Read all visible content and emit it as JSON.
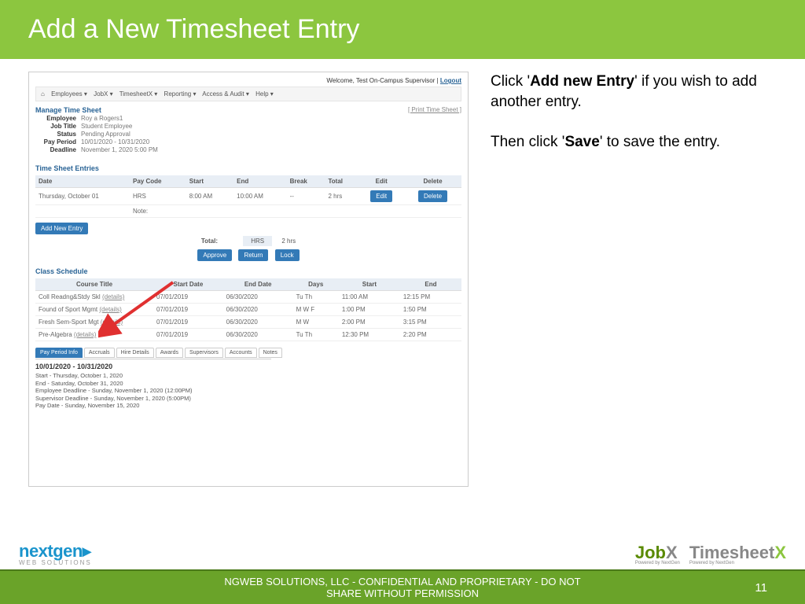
{
  "slide": {
    "title": "Add a New Timesheet Entry",
    "inst1a": "Click '",
    "inst1b": "Add new Entry",
    "inst1c": "' if you wish to add another entry.",
    "inst2a": "Then click '",
    "inst2b": "Save",
    "inst2c": "' to save the entry."
  },
  "app": {
    "welcome": "Welcome, Test On-Campus Supervisor  |  ",
    "logout": "Logout",
    "nav": {
      "home": "⌂",
      "emp": "Employees ▾",
      "jobx": "JobX ▾",
      "tsx": "TimesheetX ▾",
      "rep": "Reporting ▾",
      "acc": "Access & Audit ▾",
      "help": "Help ▾"
    },
    "manage": "Manage Time Sheet",
    "print": "[ Print Time Sheet ]",
    "info": {
      "employee_l": "Employee",
      "employee_v": "Roy a Rogers1",
      "jobtitle_l": "Job Title",
      "jobtitle_v": "Student Employee",
      "status_l": "Status",
      "status_v": "Pending Approval",
      "payperiod_l": "Pay Period",
      "payperiod_v": "10/01/2020 - 10/31/2020",
      "deadline_l": "Deadline",
      "deadline_v": "November 1, 2020 5:00 PM"
    },
    "entries_title": "Time Sheet Entries",
    "cols": {
      "date": "Date",
      "paycode": "Pay Code",
      "start": "Start",
      "end": "End",
      "break": "Break",
      "total": "Total",
      "edit": "Edit",
      "delete": "Delete"
    },
    "row": {
      "date": "Thursday, October 01",
      "paycode": "HRS",
      "start": "8:00 AM",
      "end": "10:00 AM",
      "break": "--",
      "total": "2 hrs",
      "note_l": "Note:",
      "edit": "Edit",
      "delete": "Delete"
    },
    "add_entry": "Add New Entry",
    "totals": {
      "label": "Total:",
      "code": "HRS",
      "hrs": "2 hrs"
    },
    "actions": {
      "approve": "Approve",
      "return": "Return",
      "lock": "Lock"
    },
    "class_title": "Class Schedule",
    "class_cols": {
      "title": "Course Title",
      "sd": "Start Date",
      "ed": "End Date",
      "days": "Days",
      "start": "Start",
      "end": "End"
    },
    "classes": [
      {
        "title": "Coll Readng&Stdy Skl ",
        "d": "(details)",
        "sd": "07/01/2019",
        "ed": "06/30/2020",
        "days": "Tu Th",
        "start": "11:00 AM",
        "end": "12:15 PM"
      },
      {
        "title": "Found of Sport Mgmt ",
        "d": "(details)",
        "sd": "07/01/2019",
        "ed": "06/30/2020",
        "days": "M W F",
        "start": "1:00 PM",
        "end": "1:50 PM"
      },
      {
        "title": "Fresh Sem-Sport Mgt ",
        "d": "(details)",
        "sd": "07/01/2019",
        "ed": "06/30/2020",
        "days": "M W",
        "start": "2:00 PM",
        "end": "3:15 PM"
      },
      {
        "title": "Pre-Algebra ",
        "d": "(details)",
        "sd": "07/01/2019",
        "ed": "06/30/2020",
        "days": "Tu Th",
        "start": "12:30 PM",
        "end": "2:20 PM"
      }
    ],
    "tabs": {
      "t1": "Pay Period Info",
      "t2": "Accruals",
      "t3": "Hire Details",
      "t4": "Awards",
      "t5": "Supervisors",
      "t6": "Accounts",
      "t7": "Notes"
    },
    "period": {
      "range": "10/01/2020 - 10/31/2020",
      "start": "Start - Thursday, October 1, 2020",
      "end": "End - Saturday, October 31, 2020",
      "emp_dl": "Employee Deadline - Sunday, November 1, 2020 (12:00PM)",
      "sup_dl": "Supervisor Deadline - Sunday, November 1, 2020 (5:00PM)",
      "paydate": "Pay Date - Sunday, November 15, 2020"
    }
  },
  "footer": {
    "ng": "nextgen",
    "ng_sub": "WEB SOLUTIONS",
    "jobx": "Job",
    "jobx_x": "X",
    "jobx_sub": "Powered by NextGen",
    "tsx": "Timesheet",
    "tsx_x": "X",
    "tsx_sub": "Powered by NextGen",
    "conf1": "NGWEB SOLUTIONS, LLC - CONFIDENTIAL AND  PROPRIETARY - DO NOT",
    "conf2": "SHARE WITHOUT PERMISSION",
    "page": "11"
  }
}
